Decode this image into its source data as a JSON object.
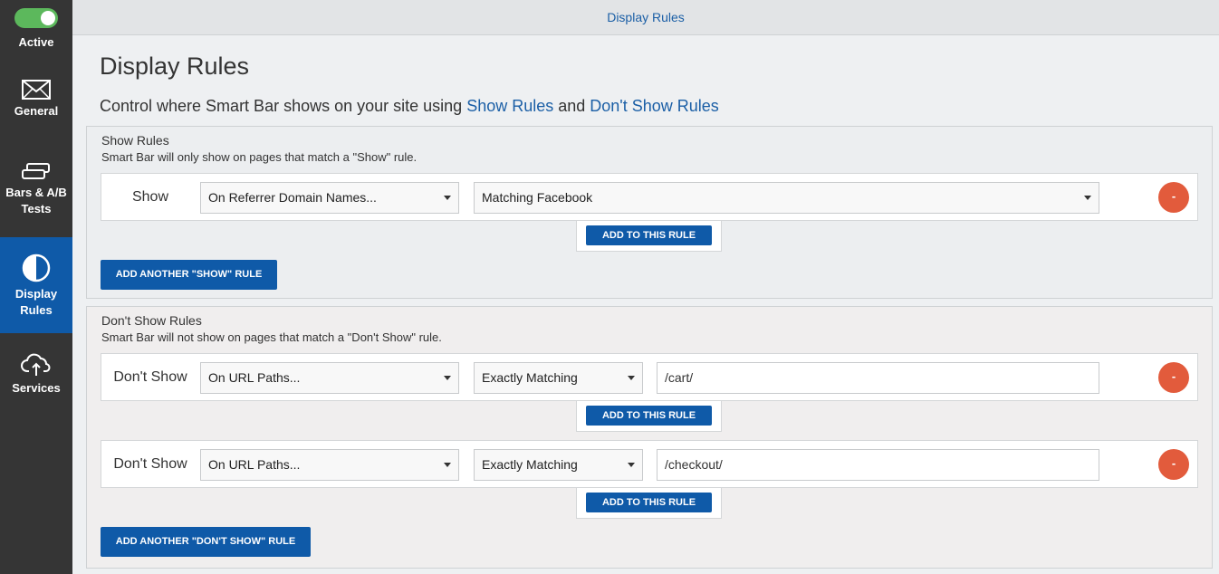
{
  "sidebar": {
    "toggle_label": "Active",
    "items": [
      {
        "label_lines": [
          "General"
        ],
        "icon": "envelope-icon"
      },
      {
        "label_lines": [
          "Bars & A/B",
          "Tests"
        ],
        "icon": "bars-icon"
      },
      {
        "label_lines": [
          "Display",
          "Rules"
        ],
        "icon": "half-circle-icon",
        "active": true
      },
      {
        "label_lines": [
          "Services"
        ],
        "icon": "cloud-upload-icon"
      }
    ]
  },
  "topbar": {
    "title": "Display Rules"
  },
  "main": {
    "title": "Display Rules",
    "subtitle_prefix": "Control where Smart Bar shows on your site using ",
    "subtitle_link1": "Show Rules",
    "subtitle_and": " and ",
    "subtitle_link2": "Don't Show Rules"
  },
  "show_rules": {
    "title": "Show Rules",
    "description": "Smart Bar will only show on pages that match a \"Show\" rule.",
    "rules": [
      {
        "label": "Show",
        "condition": "On Referrer Domain Names...",
        "value": "Matching Facebook",
        "remove": "-",
        "add_label": "ADD TO THIS RULE"
      }
    ],
    "add_another_label": "ADD ANOTHER \"SHOW\" RULE"
  },
  "dont_show_rules": {
    "title": "Don't Show Rules",
    "description": "Smart Bar will not show on pages that match a \"Don't Show\" rule.",
    "rules": [
      {
        "label": "Don't Show",
        "condition": "On URL Paths...",
        "match": "Exactly Matching",
        "value": "/cart/",
        "remove": "-",
        "add_label": "ADD TO THIS RULE"
      },
      {
        "label": "Don't Show",
        "condition": "On URL Paths...",
        "match": "Exactly Matching",
        "value": "/checkout/",
        "remove": "-",
        "add_label": "ADD TO THIS RULE"
      }
    ],
    "add_another_label": "ADD ANOTHER \"DON'T SHOW\" RULE"
  },
  "colors": {
    "sidebar": "#353535",
    "accent": "#0f5aa8",
    "remove": "#e25b3c",
    "toggle": "#5cb85c"
  }
}
